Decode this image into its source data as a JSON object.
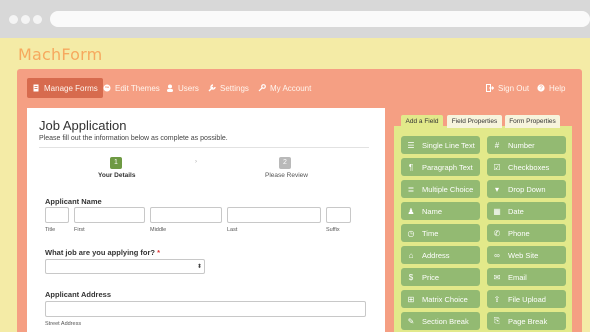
{
  "app": {
    "logo": "MachForm"
  },
  "nav": {
    "left": [
      {
        "label": "Manage Forms",
        "icon": "document-icon",
        "active": true
      },
      {
        "label": "Edit Themes",
        "icon": "palette-icon"
      },
      {
        "label": "Users",
        "icon": "user-icon"
      },
      {
        "label": "Settings",
        "icon": "wrench-icon"
      },
      {
        "label": "My Account",
        "icon": "key-icon"
      }
    ],
    "right": [
      {
        "label": "Sign Out",
        "icon": "sign-out-icon"
      },
      {
        "label": "Help",
        "icon": "help-icon"
      }
    ]
  },
  "form": {
    "title": "Job Application",
    "description": "Please fill out the information below as complete as possible.",
    "steps": [
      {
        "number": "1",
        "label": "Your Details",
        "current": true
      },
      {
        "number": "2",
        "label": "Please Review",
        "current": false
      }
    ],
    "applicant_name": {
      "label": "Applicant Name",
      "subs": [
        "Title",
        "First",
        "Middle",
        "Last",
        "Suffix"
      ]
    },
    "job": {
      "label": "What job are you applying for?",
      "required_mark": "*",
      "arrow": "⬍"
    },
    "address": {
      "label": "Applicant Address",
      "sub": "Street Address"
    }
  },
  "tabs": [
    {
      "label": "Add a Field",
      "active": true
    },
    {
      "label": "Field Properties",
      "active": false
    },
    {
      "label": "Form Properties",
      "active": false
    }
  ],
  "fields": [
    {
      "label": "Single Line Text",
      "icon": "text-line-icon",
      "glyph": "☰"
    },
    {
      "label": "Number",
      "icon": "number-icon",
      "glyph": "#"
    },
    {
      "label": "Paragraph Text",
      "icon": "paragraph-icon",
      "glyph": "¶"
    },
    {
      "label": "Checkboxes",
      "icon": "checkbox-icon",
      "glyph": "☑"
    },
    {
      "label": "Multiple Choice",
      "icon": "list-icon",
      "glyph": "≣"
    },
    {
      "label": "Drop Down",
      "icon": "dropdown-icon",
      "glyph": "▾"
    },
    {
      "label": "Name",
      "icon": "person-icon",
      "glyph": "♟"
    },
    {
      "label": "Date",
      "icon": "calendar-icon",
      "glyph": "▦"
    },
    {
      "label": "Time",
      "icon": "clock-icon",
      "glyph": "◷"
    },
    {
      "label": "Phone",
      "icon": "phone-icon",
      "glyph": "✆"
    },
    {
      "label": "Address",
      "icon": "home-icon",
      "glyph": "⌂"
    },
    {
      "label": "Web Site",
      "icon": "link-icon",
      "glyph": "∞"
    },
    {
      "label": "Price",
      "icon": "price-icon",
      "glyph": "$"
    },
    {
      "label": "Email",
      "icon": "email-icon",
      "glyph": "✉"
    },
    {
      "label": "Matrix Choice",
      "icon": "matrix-icon",
      "glyph": "⊞"
    },
    {
      "label": "File Upload",
      "icon": "upload-icon",
      "glyph": "⇪"
    },
    {
      "label": "Section Break",
      "icon": "section-icon",
      "glyph": "✎"
    },
    {
      "label": "Page Break",
      "icon": "page-break-icon",
      "glyph": "⎘"
    }
  ],
  "colors": {
    "frame": "#f59f83",
    "active_nav": "#d76b4e",
    "field_button": "#93ba72",
    "step_current": "#6e9a43",
    "step_pending": "#b9b9b9"
  }
}
